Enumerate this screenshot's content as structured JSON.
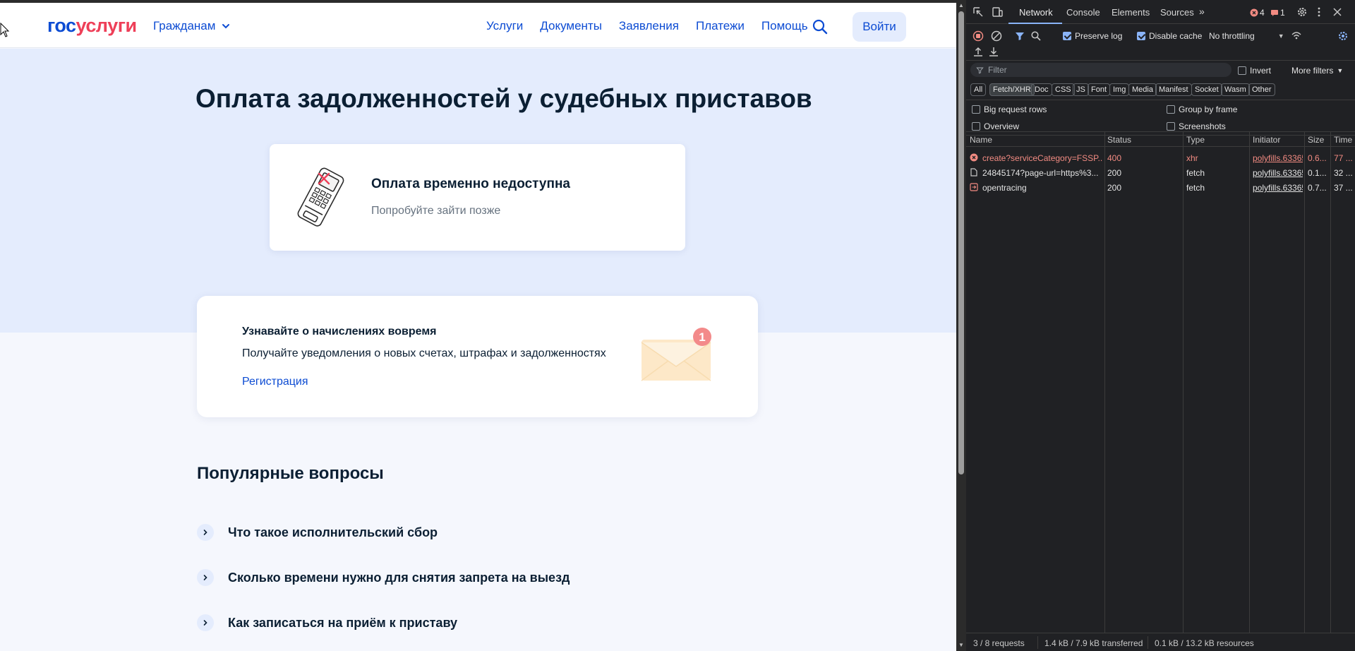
{
  "page": {
    "logo": {
      "part1": "гос",
      "part2": "услуги"
    },
    "audience_menu": "Гражданам",
    "nav": [
      "Услуги",
      "Документы",
      "Заявления",
      "Платежи",
      "Помощь"
    ],
    "login_label": "Войти",
    "title": "Оплата задолженностей у судебных приставов",
    "unavailable": {
      "title": "Оплата временно недоступна",
      "subtitle": "Попробуйте зайти позже"
    },
    "notify": {
      "title": "Узнавайте о начислениях вовремя",
      "text": "Получайте уведомления о новых счетах, штрафах и задолженностях",
      "link": "Регистрация",
      "badge": "1"
    },
    "faq": {
      "title": "Популярные вопросы",
      "items": [
        "Что такое исполнительский сбор",
        "Сколько времени нужно для снятия запрета на выезд",
        "Как записаться на приём к приставу"
      ]
    },
    "colors": {
      "brand_blue": "#0d4cd3",
      "brand_red": "#ee3f58",
      "hero_bg": "#e4ecfd"
    }
  },
  "devtools": {
    "tabs": [
      "Network",
      "Console",
      "Elements",
      "Sources"
    ],
    "active_tab": "Network",
    "errors_count": "4",
    "messages_count": "1",
    "toolbar": {
      "preserve_log": "Preserve log",
      "disable_cache": "Disable cache",
      "throttling": "No throttling"
    },
    "filter": {
      "placeholder": "Filter",
      "invert": "Invert",
      "more_filters": "More filters"
    },
    "type_filters": [
      "All",
      "Fetch/XHR",
      "Doc",
      "CSS",
      "JS",
      "Font",
      "Img",
      "Media",
      "Manifest",
      "Socket",
      "Wasm",
      "Other"
    ],
    "active_type": "Fetch/XHR",
    "options": {
      "big_request_rows": "Big request rows",
      "group_by_frame": "Group by frame",
      "overview": "Overview",
      "screenshots": "Screenshots"
    },
    "columns": [
      "Name",
      "Status",
      "Type",
      "Initiator",
      "Size",
      "Time"
    ],
    "requests": [
      {
        "name": "create?serviceCategory=FSSP...",
        "status": "400",
        "type": "xhr",
        "initiator": "polyfills.63365",
        "size": "0.6...",
        "time": "77 ...",
        "error": true
      },
      {
        "name": "24845174?page-url=https%3...",
        "status": "200",
        "type": "fetch",
        "initiator": "polyfills.63365",
        "size": "0.1...",
        "time": "32 ...",
        "error": false
      },
      {
        "name": "opentracing",
        "status": "200",
        "type": "fetch",
        "initiator": "polyfills.63365",
        "size": "0.7...",
        "time": "37 ...",
        "error": false
      }
    ],
    "status_bar": {
      "requests": "3 / 8 requests",
      "transferred": "1.4 kB / 7.9 kB transferred",
      "resources": "0.1 kB / 13.2 kB resources"
    }
  }
}
